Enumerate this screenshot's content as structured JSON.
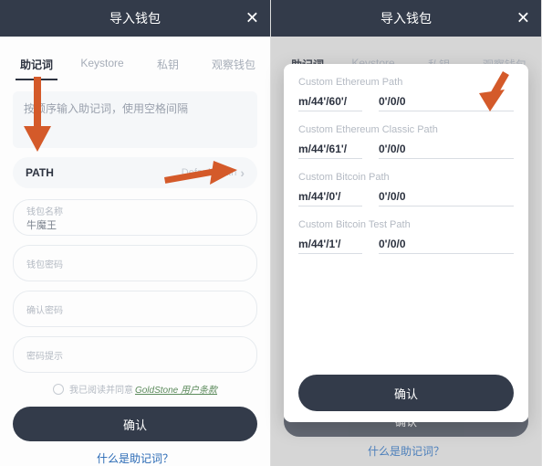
{
  "header": {
    "title": "导入钱包"
  },
  "tabs": [
    "助记词",
    "Keystore",
    "私钥",
    "观察钱包"
  ],
  "active_tab_index": 0,
  "left": {
    "mnemonic_placeholder": "按顺序输入助记词，使用空格间隔",
    "path": {
      "label": "PATH",
      "value_hint": "Default Path"
    },
    "fields": {
      "wallet_name": {
        "label": "钱包名称",
        "value": "牛魔王"
      },
      "wallet_password": {
        "label": "钱包密码",
        "value": ""
      },
      "confirm_password": {
        "label": "确认密码",
        "value": ""
      },
      "password_hint": {
        "label": "密码提示",
        "value": ""
      }
    },
    "terms": {
      "prefix": "我已阅读并同意",
      "link": "GoldStone 用户条款"
    },
    "confirm": "确认",
    "help": "什么是助记词？"
  },
  "right": {
    "modal": {
      "sections": [
        {
          "label": "Custom Ethereum Path",
          "prefix": "m/44'/60'/",
          "value": "0'/0/0"
        },
        {
          "label": "Custom Ethereum Classic Path",
          "prefix": "m/44'/61'/",
          "value": "0'/0/0"
        },
        {
          "label": "Custom Bitcoin Path",
          "prefix": "m/44'/0'/",
          "value": "0'/0/0"
        },
        {
          "label": "Custom Bitcoin Test Path",
          "prefix": "m/44'/1'/",
          "value": "0'/0/0"
        }
      ],
      "confirm": "确认"
    },
    "confirm": "确认",
    "help": "什么是助记词？"
  },
  "arrow_color": "#d45a2a"
}
